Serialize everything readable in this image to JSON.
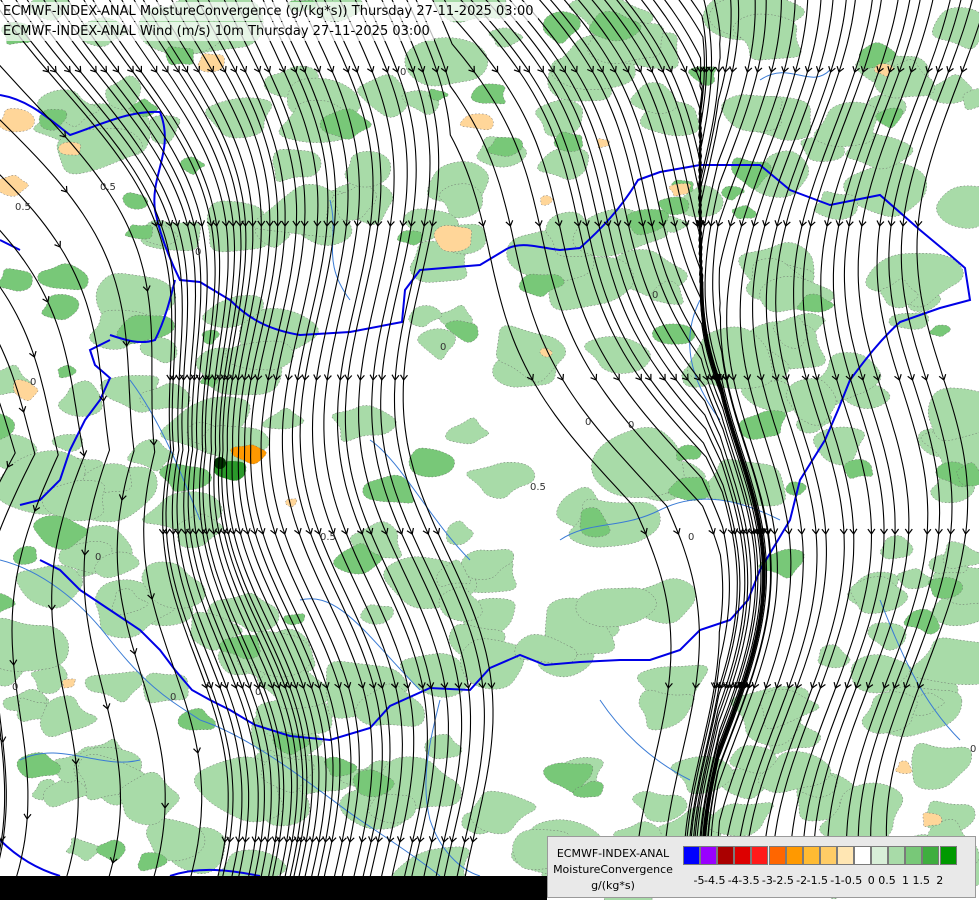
{
  "header": {
    "line1": "ECMWF-INDEX-ANAL MoistureConvergence (g/(kg*s)) Thursday 27-11-2025 03:00",
    "line2": "ECMWF-INDEX-ANAL Wind (m/s) 10m Thursday 27-11-2025 03:00"
  },
  "legend": {
    "title1": "ECMWF-INDEX-ANAL",
    "title2": "MoistureConvergence",
    "units": "g/(kg*s)",
    "swatch_colors": [
      "#0000ff",
      "#9900ff",
      "#aa0000",
      "#dd0000",
      "#ff1a1a",
      "#ff6600",
      "#ff9900",
      "#ffbb33",
      "#ffcc66",
      "#ffe6b3",
      "#ffffff",
      "#d8efd8",
      "#a8dba8",
      "#78c878",
      "#3fae3f",
      "#009900"
    ],
    "tick_labels": [
      "-5",
      "-4.5",
      "-4",
      "-3.5",
      "-3",
      "-2.5",
      "-2",
      "-1.5",
      "-1",
      "-0.5",
      "0",
      "0.5",
      "1",
      "1.5",
      "2"
    ]
  },
  "map": {
    "contour_labels": [
      "0.5",
      "0.5",
      "0",
      "0",
      "0",
      "0",
      "0",
      "0",
      "0",
      "0",
      "0",
      "0.5",
      "0.5",
      "0",
      "0",
      "0",
      "0"
    ],
    "colors": {
      "border": "#0000e6",
      "river": "#3a7bd5",
      "streamline": "#000000",
      "convergence_light": "#a8dba8",
      "convergence_mid": "#78c878",
      "convergence_dark": "#2a9a2a",
      "divergence_light": "#ffd699",
      "divergence_mid": "#ffbb33",
      "divergence_dark": "#ff9900"
    }
  }
}
